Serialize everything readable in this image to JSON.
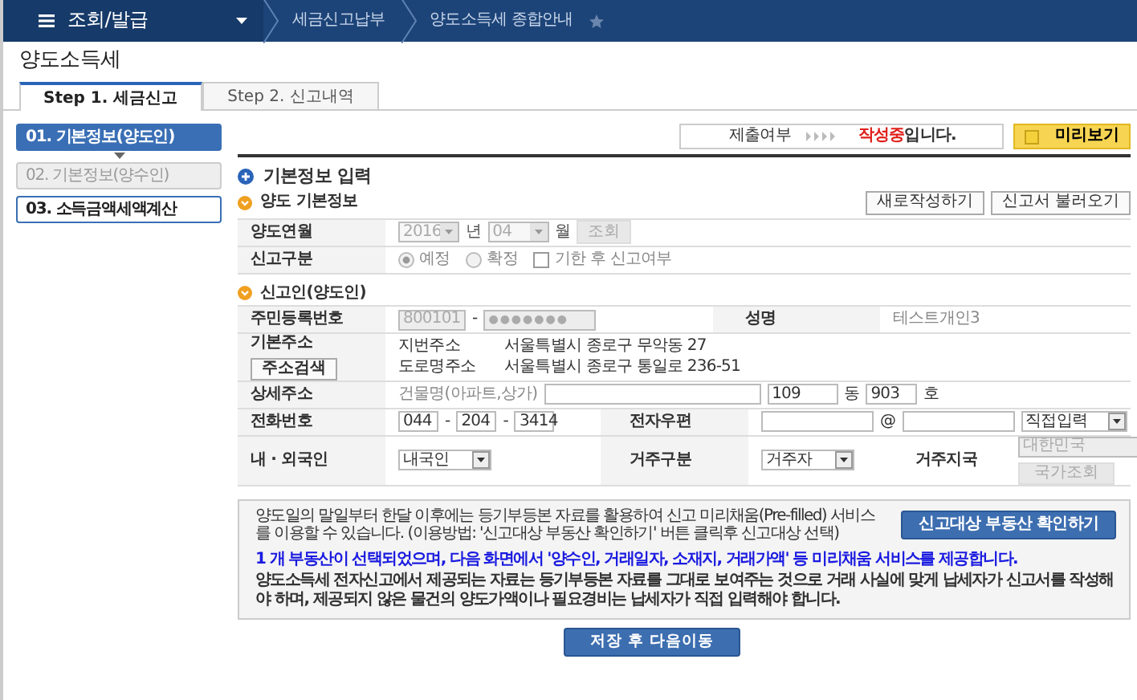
{
  "topbar": {
    "menu": "조회/발급",
    "crumbs": [
      "세금신고납부",
      "양도소득세 종합안내"
    ]
  },
  "page_title": "양도소득세",
  "tabs": [
    {
      "label": "Step 1. 세금신고",
      "selected": true
    },
    {
      "label": "Step 2. 신고내역",
      "selected": false
    }
  ],
  "steps": [
    {
      "label": "01. 기본정보(양도인)",
      "selected": true,
      "disabled": false
    },
    {
      "label": "02. 기본정보(양수인)",
      "selected": false,
      "disabled": true
    },
    {
      "label": "03. 소득금액세액계산",
      "selected": false,
      "disabled": false
    }
  ],
  "submit_status": {
    "label": "제출여부",
    "status": "작성중",
    "suffix": "입니다."
  },
  "preview_button": "미리보기",
  "section_title": "기본정보 입력",
  "actions": [
    "새로작성하기",
    "신고서 불러오기"
  ],
  "transfer": {
    "title": "양도 기본정보",
    "period_label": "양도연월",
    "year": "2016",
    "year_unit": "년",
    "month": "04",
    "month_unit": "월",
    "lookup": "조회",
    "type_label": "신고구분",
    "radios": [
      {
        "label": "예정",
        "selected": true
      },
      {
        "label": "확정",
        "selected": false
      }
    ],
    "late": {
      "label": "기한 후 신고여부",
      "checked": false
    }
  },
  "applicant": {
    "title": "신고인(양도인)",
    "id_label": "주민등록번호",
    "id_front": "800101",
    "id_sep": "-",
    "id_back": "●●●●●●●",
    "name_label": "성명",
    "name": "테스트개인3",
    "addr_label": "기본주소",
    "addr_button": "주소검색",
    "addresses": [
      {
        "kind": "지번주소",
        "value": "서울특별시 종로구 무악동 27"
      },
      {
        "kind": "도로명주소",
        "value": "서울특별시 종로구 통일로 236-51"
      }
    ],
    "detail_label": "상세주소",
    "building_label": "건물명(아파트,상가)",
    "dong": "109",
    "dong_unit": "동",
    "ho": "903",
    "ho_unit": "호",
    "phone_label": "전화번호",
    "phone": [
      "044",
      "204",
      "3414"
    ],
    "phone_sep": "-",
    "email_label": "전자우편",
    "email_at": "@",
    "email_domain": "직접입력",
    "nation_label": "내 · 외국인",
    "nation": "내국인",
    "residence_label": "거주구분",
    "residence": "거주자",
    "country_label": "거주지국",
    "country": "대한민국",
    "country_button": "국가조회"
  },
  "notice": {
    "lines": [
      {
        "kind": "plain",
        "text": "양도일의 말일부터 한달 이후에는 등기부등본 자료를 활용하여 신고 미리채움(Pre-filled) 서비스를 이용할 수 있습니다. (이용방법: '신고대상 부동산 확인하기' 버튼 클릭후 신고대상 선택)"
      },
      {
        "kind": "highlight",
        "text": "1 개 부동산이 선택되었으며, 다음 화면에서 '양수인, 거래일자, 소재지, 거래가액' 등 미리채움 서비스를 제공합니다."
      },
      {
        "kind": "bold",
        "text": "양도소득세 전자신고에서 제공되는 자료는 등기부등본 자료를 그대로 보여주는 것으로 거래 사실에 맞게 납세자가 신고서를 작성해야 하며, 제공되지 않은 물건의 양도가액이나 필요경비는 납세자가 직접 입력해야 합니다."
      }
    ],
    "button": "신고대상 부동산 확인하기"
  },
  "save_button": "저장 후 다음이동"
}
